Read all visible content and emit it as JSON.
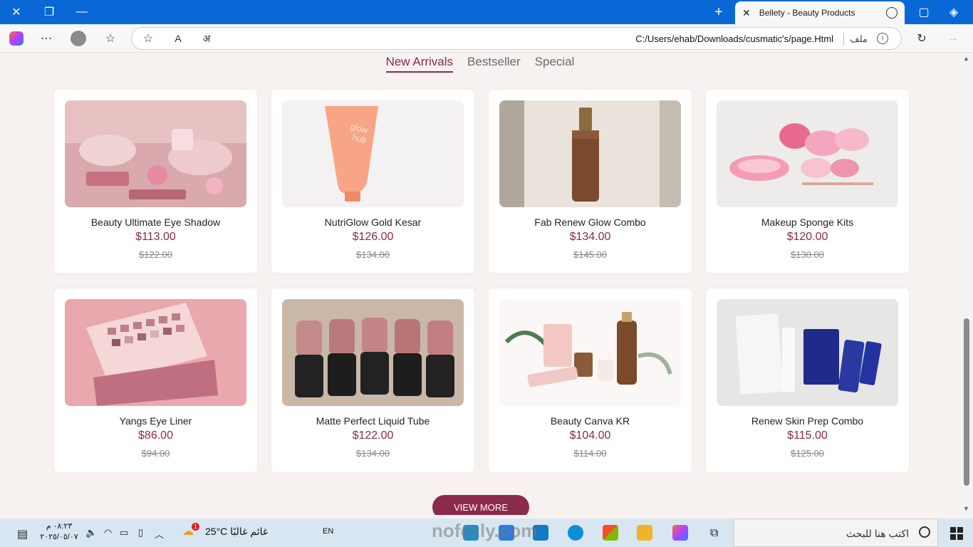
{
  "browser": {
    "tab_title": "Bellety - Beauty Products",
    "url": "C:/Users/ehab/Downloads/cusmatic's/page.Html",
    "file_label": "ملف",
    "reader_label": "A",
    "translate_label": "अ"
  },
  "page": {
    "tabs": [
      {
        "label": "New Arrivals",
        "active": true
      },
      {
        "label": "Bestseller",
        "active": false
      },
      {
        "label": "Special",
        "active": false
      }
    ],
    "products": [
      {
        "name": "Beauty Ultimate Eye Shadow",
        "price": "$113.00",
        "old_price": "$122.00",
        "image": "pink-makeup-flatlay"
      },
      {
        "name": "NutriGlow Gold Kesar",
        "price": "$126.00",
        "old_price": "$134.00",
        "image": "peach-tube"
      },
      {
        "name": "Fab Renew Glow Combo",
        "price": "$134.00",
        "old_price": "$145.00",
        "image": "foundation-bottle"
      },
      {
        "name": "Makeup Sponge Kits",
        "price": "$120.00",
        "old_price": "$130.00",
        "image": "pink-sponges"
      },
      {
        "name": "Yangs Eye Liner",
        "price": "$86.00",
        "old_price": "$94.00",
        "image": "eyeshadow-palette"
      },
      {
        "name": "Matte Perfect Liquid Tube",
        "price": "$122.00",
        "old_price": "$134.00",
        "image": "lipsticks"
      },
      {
        "name": "Beauty Canva KR",
        "price": "$104.00",
        "old_price": "$114.00",
        "image": "cosmetics-illustration"
      },
      {
        "name": "Renew Skin Prep Combo",
        "price": "$115.00",
        "old_price": "$125.00",
        "image": "nip-fab-products"
      }
    ],
    "view_more_label": "VIEW MORE",
    "accent_color": "#8c2a4c"
  },
  "taskbar": {
    "search_placeholder": "اكتب هنا للبحث",
    "weather": "25°C  غائم غالبًا",
    "language": "EN",
    "time": "٠٨:٢٣ م",
    "date": "٢٠٢٥/٠٥/٠٧",
    "weather_badge": "1"
  },
  "watermark": "nofezly.com"
}
